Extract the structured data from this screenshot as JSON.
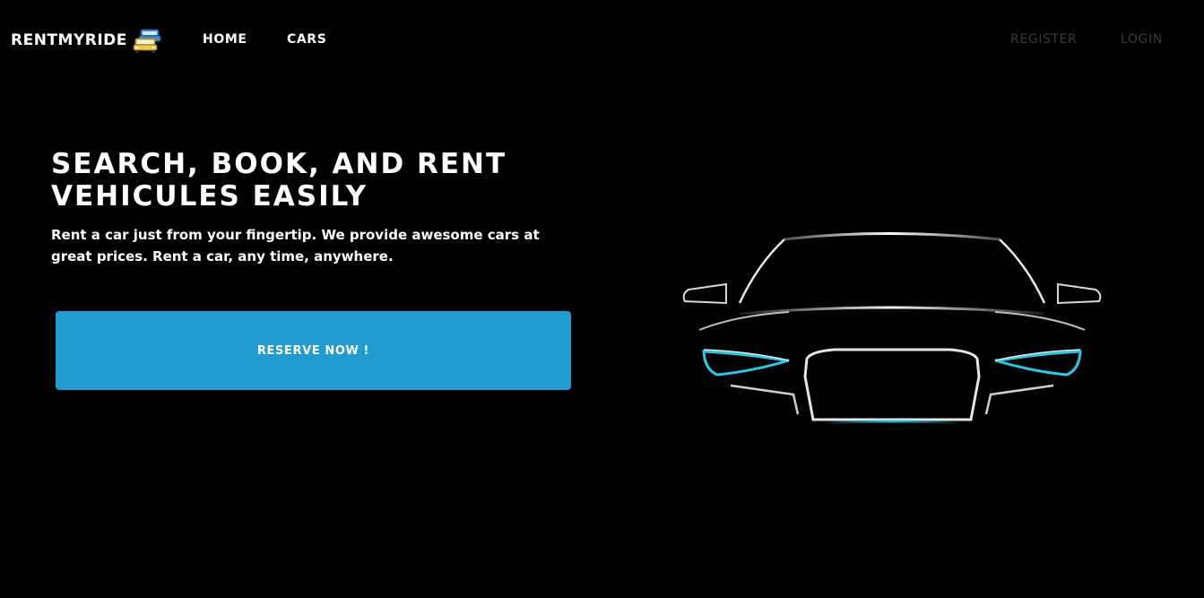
{
  "navbar": {
    "brand": "RENTMYRIDE",
    "brand_icon": "cars-icon",
    "links": {
      "home": "HOME",
      "cars": "CARS",
      "register": "REGISTER",
      "login": "LOGIN"
    }
  },
  "hero": {
    "title_line1": "SEARCH, BOOK, AND RENT",
    "title_line2": "VEHICULES EASILY",
    "description": "Rent a car just from your fingertip. We provide awesome cars at great prices. Rent a car, any time, anywhere.",
    "cta": "RESERVE NOW !",
    "image": "car-front-silhouette"
  },
  "colors": {
    "background": "#000000",
    "accent": "#229bd0",
    "headlight": "#2bc8e6",
    "muted_link": "#3a3a3a"
  }
}
